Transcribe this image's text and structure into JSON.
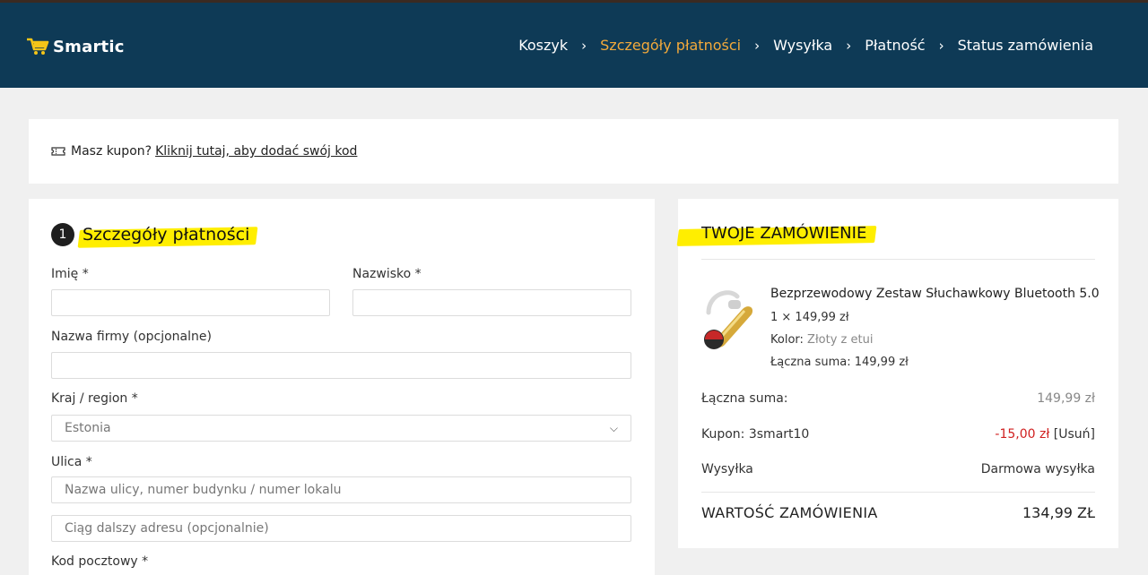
{
  "brand": {
    "name": "Smartic",
    "accent": "#f2a93b",
    "header_bg": "#0e3a56",
    "highlight": "#ffee00"
  },
  "steps": [
    {
      "label": "Koszyk",
      "active": false
    },
    {
      "label": "Szczegóły płatności",
      "active": true
    },
    {
      "label": "Wysyłka",
      "active": false
    },
    {
      "label": "Płatność",
      "active": false
    },
    {
      "label": "Status zamówienia",
      "active": false
    }
  ],
  "coupon": {
    "prompt": "Masz kupon?",
    "link": "Kliknij tutaj, aby dodać swój kod"
  },
  "billing": {
    "step_number": "1",
    "title": "Szczegóły płatności",
    "first_name_label": "Imię *",
    "last_name_label": "Nazwisko *",
    "company_label": "Nazwa firmy (opcjonalne)",
    "country_label": "Kraj / region *",
    "country_value": "Estonia",
    "street_label": "Ulica *",
    "street_placeholder": "Nazwa ulicy, numer budynku / numer lokalu",
    "street2_placeholder": "Ciąg dalszy adresu (opcjonalnie)",
    "postcode_label": "Kod pocztowy *"
  },
  "order": {
    "title": "TWOJE ZAMÓWIENIE",
    "product": {
      "name": "Bezprzewodowy Zestaw Słuchawkowy Bluetooth 5.0",
      "qty_price": "1 × 149,99 zł",
      "color_label": "Kolor:",
      "color_value": "Złoty z etui",
      "line_total": "Łączna suma: 149,99 zł"
    },
    "subtotal_label": "Łączna suma:",
    "subtotal_value": "149,99 zł",
    "coupon_label": "Kupon: 3smart10",
    "coupon_value": "-15,00 zł",
    "coupon_remove": "[Usuń]",
    "shipping_label": "Wysyłka",
    "shipping_value": "Darmowa wysyłka",
    "total_label": "WARTOŚĆ ZAMÓWIENIA",
    "total_value": "134,99 ZŁ"
  }
}
